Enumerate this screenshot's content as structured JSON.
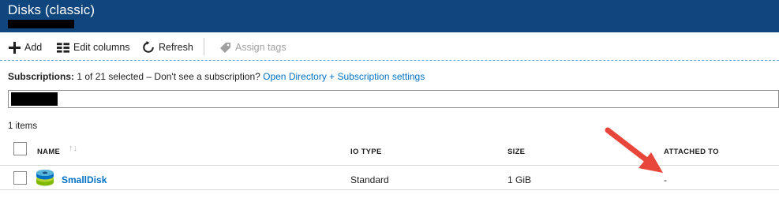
{
  "window": {
    "title": "Disks (classic)"
  },
  "toolbar": {
    "add_label": "Add",
    "edit_columns_label": "Edit columns",
    "refresh_label": "Refresh",
    "assign_tags_label": "Assign tags"
  },
  "subscriptions": {
    "label": "Subscriptions:",
    "text": " 1 of 21 selected – Don't see a subscription? ",
    "link": "Open Directory + Subscription settings"
  },
  "list": {
    "count": "1 items",
    "columns": {
      "name": "NAME",
      "io_type": "IO TYPE",
      "size": "SIZE",
      "attached_to": "ATTACHED TO"
    },
    "rows": [
      {
        "name": "SmallDisk",
        "io_type": "Standard",
        "size": "1 GiB",
        "attached_to": "-"
      }
    ]
  },
  "colors": {
    "header": "#0f467e",
    "link": "#0072c6",
    "arrow": "#e8463a"
  }
}
